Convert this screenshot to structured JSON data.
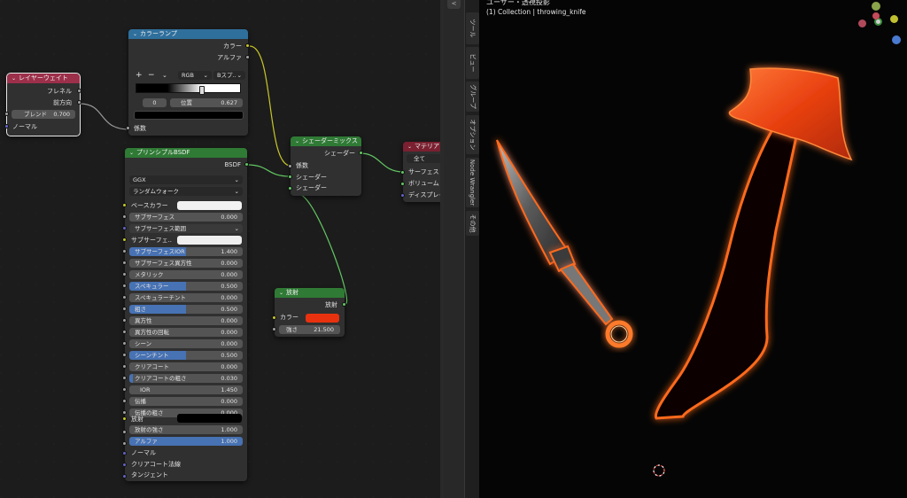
{
  "colorramp": {
    "title": "カラーランプ",
    "out_color": "カラー",
    "out_alpha": "アルファ",
    "plus": "+",
    "minus": "−",
    "menu_chev": "⌄",
    "mode": "RGB",
    "interp": "Bスプ..",
    "index": "0",
    "pos_label": "位置",
    "pos_value": "0.627",
    "in_fac": "係数"
  },
  "layerweight": {
    "title": "レイヤーウェイト",
    "out_fresnel": "フレネル",
    "out_facing": "前方向",
    "blend_label": "ブレンド",
    "blend_value": "0.700",
    "in_normal": "ノーマル"
  },
  "mix": {
    "title": "シェーダーミックス",
    "out_shader": "シェーダー",
    "in_fac": "係数",
    "in_shader1": "シェーダー",
    "in_shader2": "シェーダー"
  },
  "output": {
    "title": "マテリア",
    "target": "全て",
    "in_surface": "サーフェス",
    "in_volume": "ボリューム",
    "in_disp": "ディスプレイ"
  },
  "emission": {
    "title": "放射",
    "out_emission": "放射",
    "color_label": "カラー",
    "strength_label": "強さ",
    "strength_value": "21.500",
    "color": "#e8320f"
  },
  "bsdf": {
    "title": "プリンシプルBSDF",
    "out_bsdf": "BSDF",
    "distribution": "GGX",
    "subsurface_method": "ランダムウォーク",
    "base_color": "ベースカラー",
    "subsurface": [
      "サブサーフェス",
      "0.000"
    ],
    "subsurface_radius": "サブサーフェス範囲",
    "subsurface_color": "サブサーフェ..",
    "subsurface_ior": [
      "サブサーフェスIOR",
      "1.400"
    ],
    "subsurface_aniso": [
      "サブサーフェス異方性",
      "0.000"
    ],
    "metallic": [
      "メタリック",
      "0.000"
    ],
    "specular": [
      "スペキュラー",
      "0.500"
    ],
    "specular_tint": [
      "スペキュラーチント",
      "0.000"
    ],
    "roughness": [
      "粗さ",
      "0.500"
    ],
    "anisotropic": [
      "異方性",
      "0.000"
    ],
    "aniso_rotation": [
      "異方性の回転",
      "0.000"
    ],
    "sheen": [
      "シーン",
      "0.000"
    ],
    "sheen_tint": [
      "シーンチント",
      "0.500"
    ],
    "clearcoat": [
      "クリアコート",
      "0.000"
    ],
    "clearcoat_rough": [
      "クリアコートの粗さ",
      "0.030"
    ],
    "ior": [
      "IOR",
      "1.450"
    ],
    "transmission": [
      "伝播",
      "0.000"
    ],
    "transmission_rough": [
      "伝播の粗さ",
      "0.000"
    ],
    "emission": "放射",
    "emission_strength": [
      "放射の強さ",
      "1.000"
    ],
    "alpha": [
      "アルファ",
      "1.000"
    ],
    "normal": "ノーマル",
    "clearcoat_normal": "クリアコート法線",
    "tangent": "タンジェント"
  },
  "sidebar": {
    "top_button": "<",
    "tabs": [
      "ツール",
      "ビュー",
      "グループ",
      "オプション",
      "Node Wrangler",
      "その他"
    ]
  },
  "viewport": {
    "title": "ユーザー・透視投影",
    "subtitle": "(1) Collection | throwing_knife"
  },
  "colors": {
    "accent_blue": "#4772b3",
    "glow": "#ff5a14",
    "header_colorramp": "#2f6f9c",
    "header_shader": "#2f7a35",
    "header_input": "#9c2f4a",
    "header_output": "#7a2030"
  }
}
